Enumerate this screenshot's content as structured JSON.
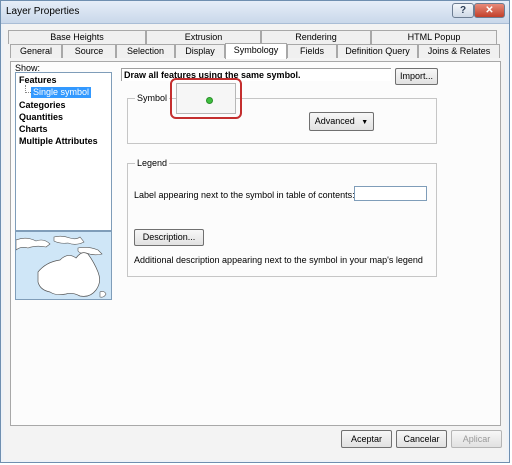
{
  "window": {
    "title": "Layer Properties",
    "help_glyph": "?",
    "close_glyph": "✕"
  },
  "tabs": {
    "row1": [
      "Base Heights",
      "Extrusion",
      "Rendering",
      "HTML Popup"
    ],
    "row2": [
      "General",
      "Source",
      "Selection",
      "Display",
      "Symbology",
      "Fields",
      "Definition Query",
      "Joins & Relates"
    ],
    "active": "Symbology"
  },
  "show_panel": {
    "label": "Show:",
    "items": [
      "Features",
      "Categories",
      "Quantities",
      "Charts",
      "Multiple Attributes"
    ],
    "selected_subitem": "Single symbol"
  },
  "main": {
    "header": "Draw all features using the same symbol.",
    "import_label": "Import...",
    "symbol_group": "Symbol",
    "advanced_label": "Advanced",
    "legend_group": "Legend",
    "legend_label_text": "Label appearing next to the symbol in table of contents:",
    "label_value": "",
    "description_button": "Description...",
    "description_text": "Additional description appearing next to the symbol in your map's legend"
  },
  "footer": {
    "ok": "Aceptar",
    "cancel": "Cancelar",
    "apply": "Aplicar"
  },
  "colors": {
    "selection": "#3399ff",
    "highlight_border": "#c42e2e",
    "symbol_point": "#3fbf3f"
  }
}
